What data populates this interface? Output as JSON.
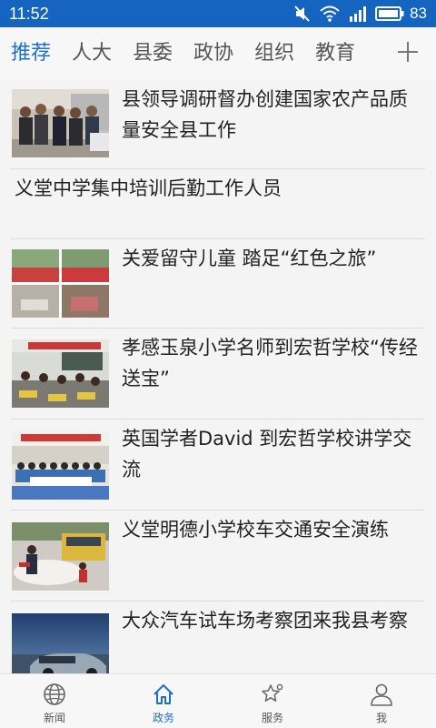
{
  "status": {
    "time": "11:52",
    "battery": "83"
  },
  "tabs": [
    {
      "label": "推荐",
      "active": true
    },
    {
      "label": "人大",
      "active": false
    },
    {
      "label": "县委",
      "active": false
    },
    {
      "label": "政协",
      "active": false
    },
    {
      "label": "组织",
      "active": false
    },
    {
      "label": "教育",
      "active": false
    }
  ],
  "news": [
    {
      "title": "县领导调研督办创建国家农产品质量安全县工作",
      "image": "officials-visit-photo"
    },
    {
      "title": "义堂中学集中培训后勤工作人员"
    },
    {
      "title": "关爱留守儿童 踏足“红色之旅”",
      "image": "children-collage-photo"
    },
    {
      "title": "孝感玉泉小学名师到宏哲学校“传经送宝”",
      "image": "classroom-photo"
    },
    {
      "title": "英国学者David 到宏哲学校讲学交流",
      "image": "group-photo"
    },
    {
      "title": "义堂明德小学校车交通安全演练",
      "image": "school-bus-drill-photo"
    },
    {
      "title": "大众汽车试车场考察团来我县考察",
      "image": "car-photo"
    }
  ],
  "bottom_nav": [
    {
      "label": "新闻",
      "icon": "globe-icon",
      "active": false
    },
    {
      "label": "政务",
      "icon": "home-icon",
      "active": true
    },
    {
      "label": "服务",
      "icon": "star-icon",
      "active": false
    },
    {
      "label": "我",
      "icon": "person-icon",
      "active": false
    }
  ],
  "colors": {
    "status_bar": "#1565c0",
    "accent": "#1e6fc8",
    "text": "#222222"
  }
}
